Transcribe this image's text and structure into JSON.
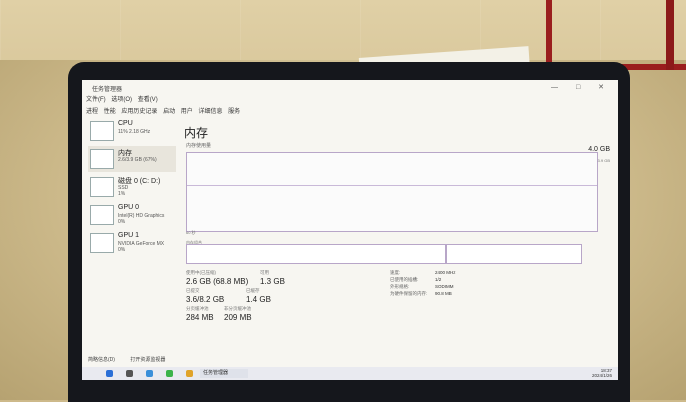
{
  "window": {
    "title": "任务管理器",
    "menu": [
      "文件(F)",
      "选项(O)",
      "查看(V)"
    ],
    "tabs": [
      "进程",
      "性能",
      "应用历史记录",
      "启动",
      "用户",
      "详细信息",
      "服务"
    ],
    "controls": "— □ ✕"
  },
  "sidebar": {
    "items": [
      {
        "title": "CPU",
        "sub1": "11% 2.18 GHz",
        "sub2": ""
      },
      {
        "title": "内存",
        "sub1": "2.6/3.9 GB (67%)",
        "sub2": ""
      },
      {
        "title": "磁盘 0 (C: D:)",
        "sub1": "SSD",
        "sub2": "1%"
      },
      {
        "title": "GPU 0",
        "sub1": "Intel(R) HD Graphics",
        "sub2": "0%"
      },
      {
        "title": "GPU 1",
        "sub1": "NVIDIA GeForce MX",
        "sub2": "0%"
      }
    ]
  },
  "main": {
    "title": "内存",
    "usage_label": "内存使用量",
    "total": "4.0 GB",
    "graph_right_value": "3.9 GB",
    "graph_left_time": "60 秒",
    "composition_label": "内存组合",
    "stats": {
      "in_use_label": "使用中(已压缩)",
      "in_use_value": "2.6 GB (68.8 MB)",
      "available_label": "可用",
      "available_value": "1.3 GB",
      "committed_label": "已提交",
      "committed_value": "3.6/8.2 GB",
      "cached_label": "已缓存",
      "cached_value": "1.4 GB",
      "paged_pool_label": "分页缓冲池",
      "paged_pool_value": "284 MB",
      "nonpaged_pool_label": "非分页缓冲池",
      "nonpaged_pool_value": "209 MB"
    },
    "info": [
      {
        "k": "速度:",
        "v": "2400 MHz"
      },
      {
        "k": "已使用的插槽:",
        "v": "1/2"
      },
      {
        "k": "外形规格:",
        "v": "SODIMM"
      },
      {
        "k": "为硬件保留的内存:",
        "v": "90.8 MB"
      }
    ]
  },
  "footer": {
    "brief": "简略信息(D)",
    "resmon": "打开资源监视器"
  },
  "taskbar": {
    "app": "任务管理器",
    "time": "18:37",
    "date": "2024/1/26"
  },
  "colors": {
    "graph_border": "#b8a6c8",
    "screen_bg": "#f7f6f1",
    "bezel": "#15171c"
  }
}
